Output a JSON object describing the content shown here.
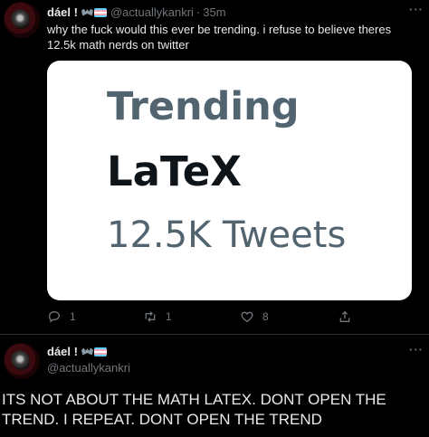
{
  "tweet1": {
    "display_name": "dáel !",
    "badges": [
      "bat-icon",
      "trans-flag-icon"
    ],
    "handle": "@actuallykankri",
    "separator": "·",
    "time": "35m",
    "more": "···",
    "text": "why the fuck would this ever be trending. i refuse to believe theres 12.5k math nerds on twitter",
    "media": {
      "label": "Trending",
      "topic": "LaTeX",
      "count": "12.5K Tweets"
    },
    "actions": {
      "replies": "1",
      "retweets": "1",
      "likes": "8"
    }
  },
  "tweet2": {
    "display_name": "dáel !",
    "badges": [
      "bat-icon",
      "trans-flag-icon"
    ],
    "handle": "@actuallykankri",
    "more": "···",
    "text": "ITS NOT ABOUT THE MATH LATEX. DONT OPEN THE TREND. I REPEAT. DONT OPEN THE TREND"
  },
  "colors": {
    "background": "#000000",
    "text": "#e7e9ea",
    "muted": "#71767b",
    "divider": "#2f3336",
    "card": "#ffffff"
  }
}
